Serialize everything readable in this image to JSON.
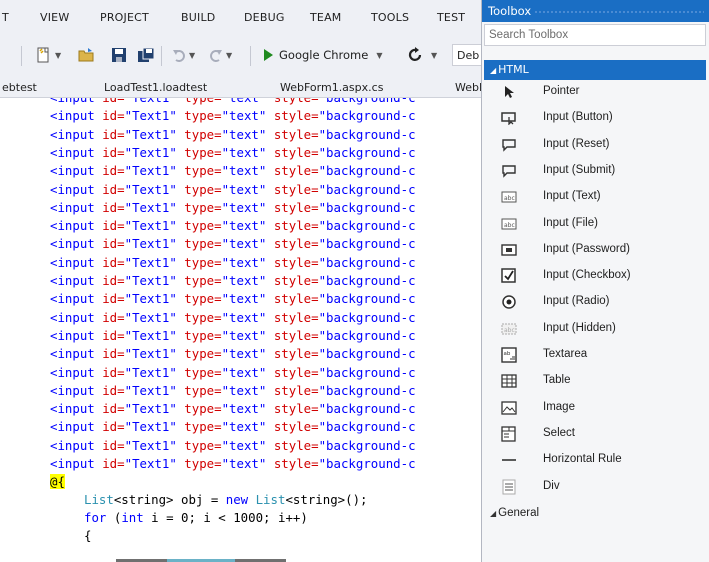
{
  "menu": [
    "T",
    "VIEW",
    "PROJECT",
    "BUILD",
    "DEBUG",
    "TEAM",
    "TOOLS",
    "TEST"
  ],
  "toolbar": {
    "browser_label": "Google Chrome",
    "debug_label": "Deb"
  },
  "tabs": [
    "ebtest",
    "LoadTest1.loadtest",
    "WebForm1.aspx.cs",
    "WebF"
  ],
  "code": {
    "input_tag": "<input",
    "id_attr": " id=",
    "id_val": "\"Text1\"",
    "type_attr": " type=",
    "type_val": "\"text\"",
    "style_attr": " style=",
    "style_val": "\"background-c",
    "razor_open": "@{",
    "line_list_a": "List",
    "line_list_b": "<string> obj = ",
    "line_list_c": "new",
    "line_list_d": " List",
    "line_list_e": "<string>();",
    "line_for_a": "for",
    "line_for_b": " (",
    "line_for_c": "int",
    "line_for_d": " i = 0; i < 1000; i++)",
    "brace": "{"
  },
  "toolbox": {
    "title": "Toolbox",
    "search_placeholder": "Search Toolbox",
    "group_html": "HTML",
    "items": [
      {
        "label": "Pointer",
        "icon": "pointer-icon"
      },
      {
        "label": "Input (Button)",
        "icon": "input-button-icon"
      },
      {
        "label": "Input (Reset)",
        "icon": "input-reset-icon"
      },
      {
        "label": "Input (Submit)",
        "icon": "input-submit-icon"
      },
      {
        "label": "Input (Text)",
        "icon": "input-text-icon"
      },
      {
        "label": "Input (File)",
        "icon": "input-file-icon"
      },
      {
        "label": "Input (Password)",
        "icon": "input-password-icon"
      },
      {
        "label": "Input (Checkbox)",
        "icon": "checkbox-icon"
      },
      {
        "label": "Input (Radio)",
        "icon": "radio-icon"
      },
      {
        "label": "Input (Hidden)",
        "icon": "input-hidden-icon"
      },
      {
        "label": "Textarea",
        "icon": "textarea-icon"
      },
      {
        "label": "Table",
        "icon": "table-icon"
      },
      {
        "label": "Image",
        "icon": "image-icon"
      },
      {
        "label": "Select",
        "icon": "select-icon"
      },
      {
        "label": "Horizontal Rule",
        "icon": "horizontal-rule-icon"
      },
      {
        "label": "Div",
        "icon": "div-icon"
      }
    ],
    "group_general": "General"
  },
  "colors": {
    "accent": "#1a6ec4",
    "code_keyword": "#0000ff",
    "code_attr": "#d10000",
    "code_type": "#2b91af",
    "razor_highlight": "#ffff00"
  }
}
